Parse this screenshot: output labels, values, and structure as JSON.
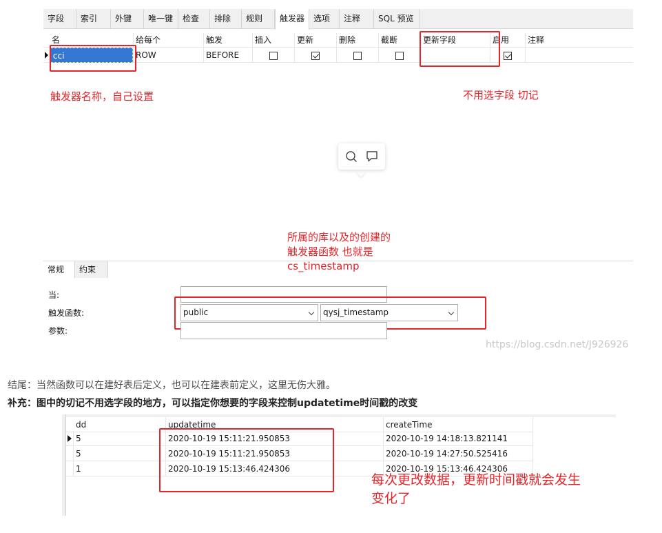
{
  "top_tabs": [
    "字段",
    "索引",
    "外键",
    "唯一键",
    "检查",
    "排除",
    "规则",
    "触发器",
    "选项",
    "注释",
    "SQL 预览"
  ],
  "active_top_tab": "触发器",
  "trigger_grid": {
    "headers": [
      "名",
      "给每个",
      "触发",
      "插入",
      "更新",
      "删除",
      "截断",
      "更新字段",
      "启用",
      "注释"
    ],
    "row": {
      "name": "cci",
      "for_each": "ROW",
      "fires": "BEFORE",
      "insert": false,
      "update": true,
      "delete": false,
      "truncate": false,
      "update_fields": "",
      "enabled": true,
      "comment": ""
    }
  },
  "annotations": {
    "name_note": "触发器名称，自己设置",
    "fields_note": "不用选字段 切记",
    "function_note_line1": "所属的库以及的创建的",
    "function_note_line2": "触发器函数 也就是",
    "function_note_line3": "cs_timestamp",
    "table_note_line1": "每次更改数据，更新时间戳就会发生",
    "table_note_line2": "变化了"
  },
  "bottom_tabs": [
    "常规",
    "约束"
  ],
  "active_bottom_tab": "常规",
  "form": {
    "when_label": "当:",
    "when_value": "",
    "function_label": "触发函数:",
    "schema_value": "public",
    "function_value": "qysj_timestamp",
    "args_label": "参数:",
    "args_value": ""
  },
  "watermark": "https://blog.csdn.net/J926926",
  "paragraphs": {
    "conclusion": "结尾：当然函数可以在建好表后定义，也可以在建表前定义，这里无伤大雅。",
    "supplement": "补充：图中的切记不用选字段的地方，可以指定你想要的字段来控制updatetime时间戳的改变"
  },
  "data_table": {
    "headers": [
      "dd",
      "updatetime",
      "createTime"
    ],
    "rows": [
      [
        "5",
        "2020-10-19 15:11:21.950853",
        "2020-10-19 14:18:13.821141"
      ],
      [
        "5",
        "2020-10-19 15:11:21.950853",
        "2020-10-19 14:27:50.525416"
      ],
      [
        "1",
        "2020-10-19 15:13:46.424306",
        "2020-10-19 15:13:46.424306"
      ]
    ]
  },
  "colors": {
    "annotation_red": "#e5252a",
    "selection_blue": "#3478d4"
  },
  "icons": [
    "search-icon",
    "comment-icon",
    "chevron-down-icon",
    "row-indicator-icon"
  ]
}
